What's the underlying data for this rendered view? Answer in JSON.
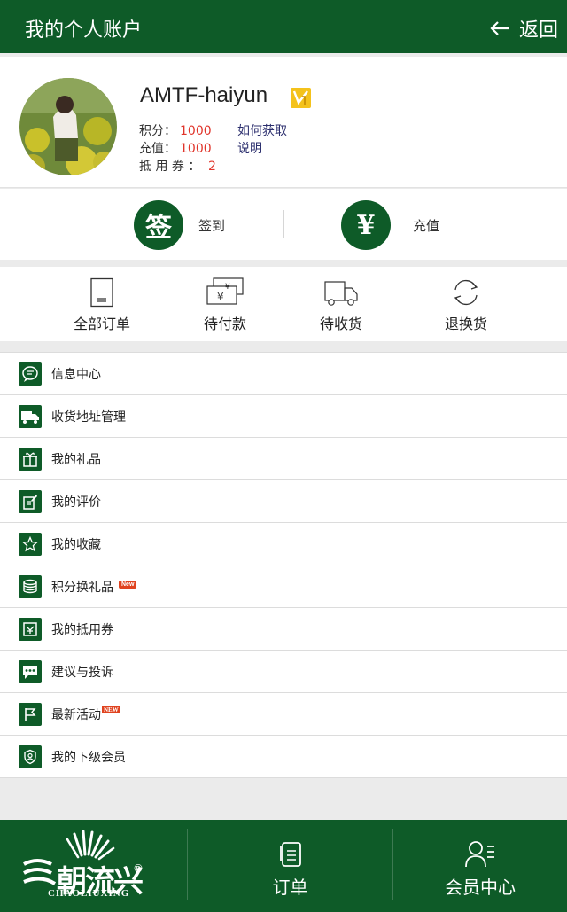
{
  "header": {
    "title": "我的个人账户",
    "back_label": "返回"
  },
  "profile": {
    "username": "AMTF-haiyun",
    "badge_icon": "vip-level-1-badge",
    "points_label": "积分：",
    "points_value": "1000",
    "points_link": "如何获取",
    "recharge_label": "充值：",
    "recharge_value": "1000",
    "recharge_link": "说明",
    "coupon_label": "抵 用 券 ：",
    "coupon_value": "2"
  },
  "quick_actions": {
    "checkin_glyph": "签",
    "checkin_label": "签到",
    "recharge_glyph": "¥",
    "recharge_label": "充值"
  },
  "orders": [
    {
      "label": "全部订单",
      "icon": "order-list-icon"
    },
    {
      "label": "待付款",
      "icon": "money-bills-icon"
    },
    {
      "label": "待收货",
      "icon": "delivery-truck-icon"
    },
    {
      "label": "退换货",
      "icon": "exchange-cycle-icon"
    }
  ],
  "menu": [
    {
      "label": "信息中心",
      "icon": "message-bubble-icon"
    },
    {
      "label": "收货地址管理",
      "icon": "truck-icon"
    },
    {
      "label": "我的礼品",
      "icon": "gift-icon"
    },
    {
      "label": "我的评价",
      "icon": "review-edit-icon"
    },
    {
      "label": "我的收藏",
      "icon": "star-icon"
    },
    {
      "label": "积分换礼品",
      "icon": "coins-stack-icon",
      "tag": "New"
    },
    {
      "label": "我的抵用券",
      "icon": "coupon-icon"
    },
    {
      "label": "建议与投诉",
      "icon": "chat-dots-icon"
    },
    {
      "label": "最新活动",
      "icon": "flag-icon",
      "tag": "NEW"
    },
    {
      "label": "我的下级会员",
      "icon": "member-shield-icon"
    }
  ],
  "bottom_nav": {
    "logo_text": "朝流兴",
    "logo_reg": "®",
    "logo_en": "CHAOLIUXING",
    "orders_label": "订单",
    "member_label": "会员中心"
  },
  "colors": {
    "brand_green": "#0e5b28",
    "value_red": "#e0352b",
    "link_navy": "#2c2f6e",
    "badge_yellow": "#f4c21b"
  }
}
